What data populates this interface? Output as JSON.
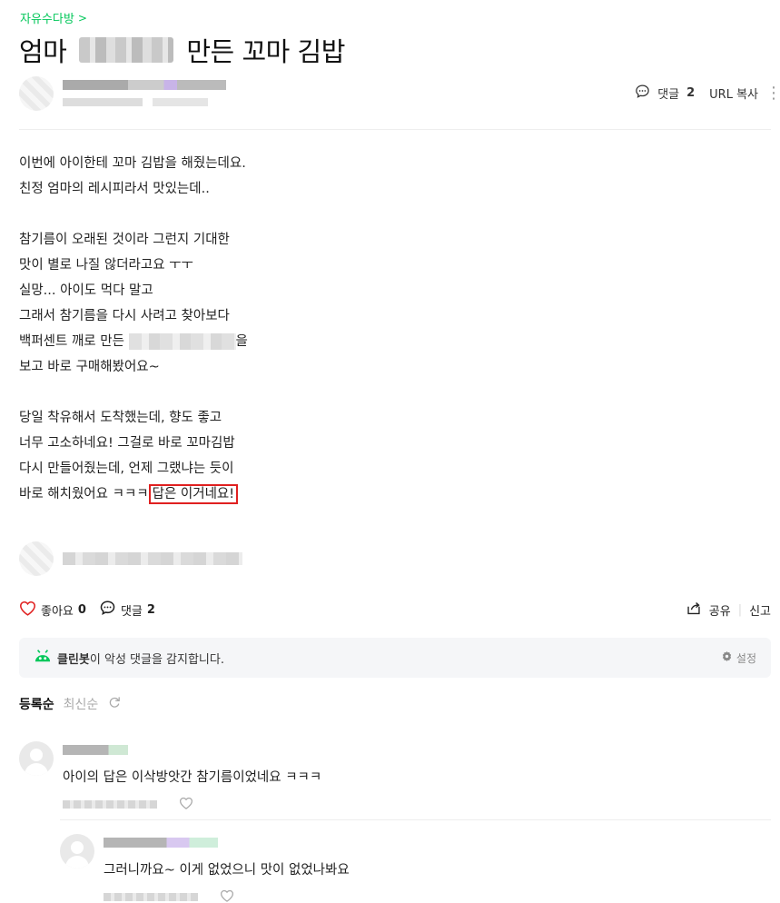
{
  "breadcrumb": {
    "board": "자유수다방",
    "chevron": ">"
  },
  "title": {
    "before": "엄마",
    "after": "만든 꼬마 김밥"
  },
  "post_meta": {
    "comment_label": "댓글",
    "comment_count": "2",
    "url_copy": "URL 복사"
  },
  "body_lines": [
    "이번에 아이한테 꼬마 김밥을 해줬는데요.",
    "친정 엄마의 레시피라서 맛있는데..",
    "",
    "참기름이 오래된 것이라  그런지 기대한",
    "맛이 별로 나질 않더라고요 ㅜㅜ",
    "실망... 아이도 먹다 말고",
    "그래서 참기름을 다시 사려고 찾아보다",
    "",
    "보고 바로 구매해봤어요~",
    "",
    "당일 착유해서 도착했는데, 향도 좋고",
    "너무 고소하네요! 그걸로 바로 꼬마김밥",
    "다시 만들어줬는데, 언제 그랬냐는 듯이",
    ""
  ],
  "body_blur_line": {
    "prefix": "백퍼센트 깨로 만든",
    "suffix": "을"
  },
  "body_last_line": {
    "prefix": "바로 해치웠어요 ㅋㅋㅋ",
    "highlight": "답은 이거네요!"
  },
  "actions": {
    "like_label": "좋아요",
    "like_count": "0",
    "comment_label": "댓글",
    "comment_count": "2",
    "share": "공유",
    "report": "신고"
  },
  "cleanbot": {
    "brand": "클린봇",
    "message": "이 악성 댓글을 감지합니다.",
    "settings": "설정"
  },
  "sort": {
    "active": "등록순",
    "inactive": "최신순"
  },
  "comments": [
    {
      "text": "아이의 답은 이삭방앗간 참기름이었네요 ㅋㅋㅋ"
    },
    {
      "text": "그러니까요~ 이게 없었으니 맛이 없었나봐요"
    }
  ],
  "colors": {
    "brand_green": "#03c75a",
    "highlight_border": "#e02020",
    "heart": "#e02020"
  },
  "icons": [
    "chevron-right-icon",
    "comment-bubble-icon",
    "kebab-menu-icon",
    "heart-icon",
    "share-icon",
    "cleanbot-icon",
    "gear-icon",
    "refresh-icon",
    "avatar-icon"
  ]
}
